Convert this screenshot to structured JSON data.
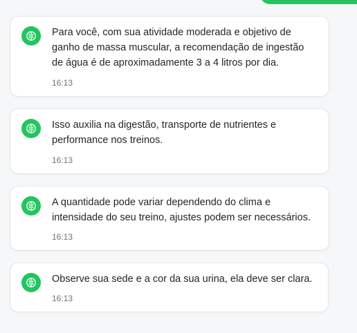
{
  "colors": {
    "accent": "#22c55e",
    "card": "#ffffff",
    "text": "#1f2328",
    "muted": "#6b7280"
  },
  "icons": {
    "assistant_avatar": "brain-icon"
  },
  "messages": [
    {
      "text": "Para você, com sua atividade moderada e objetivo de ganho de massa muscular, a recomendação de ingestão de água é de aproximadamente 3 a 4 litros por dia.",
      "time": "16:13"
    },
    {
      "text": "Isso auxilia na digestão, transporte de nutrientes e performance nos treinos.",
      "time": "16:13"
    },
    {
      "text": "A quantidade pode variar dependendo do clima e intensidade do seu treino, ajustes podem ser necessários.",
      "time": "16:13"
    },
    {
      "text": "Observe sua sede e a cor da sua urina, ela deve ser clara.",
      "time": "16:13"
    }
  ]
}
